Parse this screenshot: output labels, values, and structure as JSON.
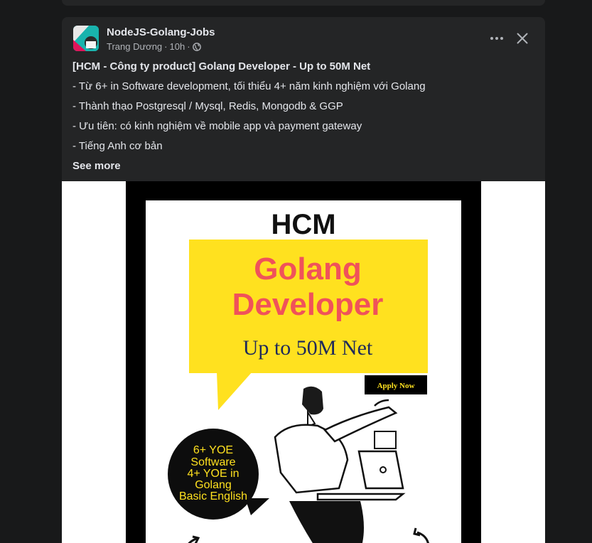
{
  "post": {
    "group_name": "NodeJS-Golang-Jobs",
    "author": "Trang Dương",
    "time": "10h",
    "separator": "·",
    "lines": [
      "[HCM - Công ty product] Golang Developer - Up to 50M Net",
      "- Từ 6+ in Software development, tối thiểu 4+ năm kinh nghiệm với Golang",
      "- Thành thạo Postgresql / Mysql, Redis, Mongodb & GGP",
      "- Ưu tiên: có kinh nghiệm về mobile app và payment gateway",
      "- Tiếng Anh cơ bản"
    ],
    "see_more": "See more"
  },
  "poster": {
    "location": "HCM",
    "role_line1": "Golang",
    "role_line2": "Developer",
    "salary": "Up to 50M Net",
    "apply": "Apply Now",
    "req1": "6+ YOE",
    "req2": "Software",
    "req3": "4+ YOE in",
    "req4": "Golang",
    "req5": "Basic English"
  },
  "colors": {
    "card_bg": "#242526",
    "page_bg": "#18191a",
    "poster_yellow": "#ffe11f",
    "poster_red": "#f0525a"
  },
  "icons": [
    "more-icon",
    "close-icon",
    "globe-icon"
  ]
}
